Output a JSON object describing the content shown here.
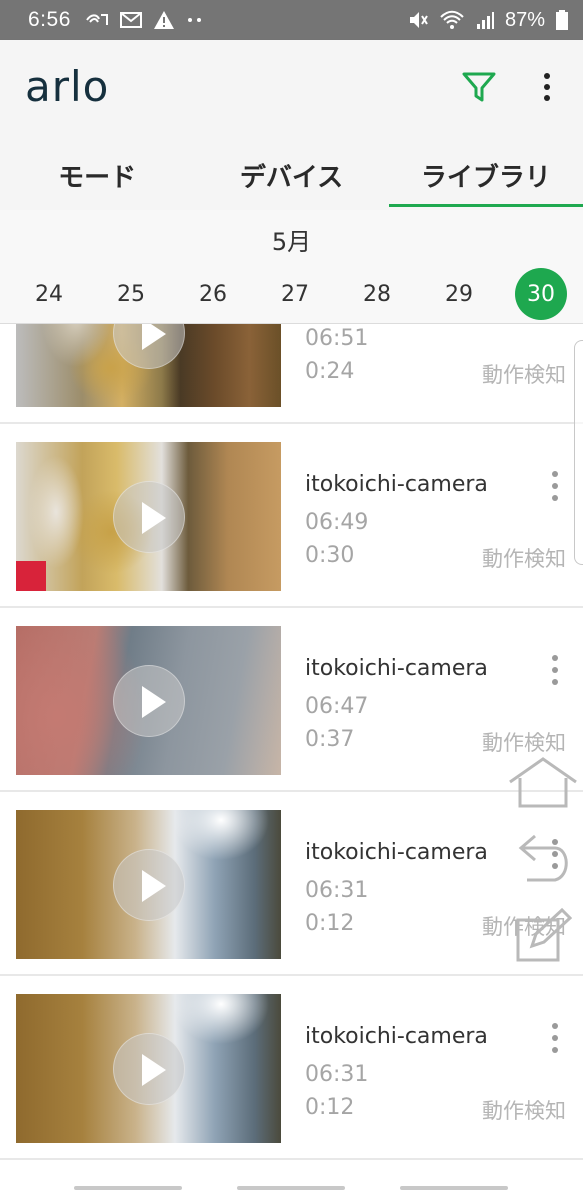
{
  "status_bar": {
    "time": "6:56",
    "battery": "87%",
    "left_icons": [
      "cast-icon",
      "mail-icon",
      "warning-icon",
      "more-dots-icon"
    ],
    "right_icons": [
      "mute-icon",
      "wifi-icon",
      "signal-icon",
      "battery-icon"
    ]
  },
  "header": {
    "logo": "arlo",
    "accent_color": "#1ea84f",
    "filter_icon": "filter-icon",
    "overflow_icon": "more-vert-icon"
  },
  "tabs": [
    {
      "label": "モード",
      "active": false
    },
    {
      "label": "デバイス",
      "active": false
    },
    {
      "label": "ライブラリ",
      "active": true
    }
  ],
  "date_strip": {
    "month": "5月",
    "days": [
      "24",
      "25",
      "26",
      "27",
      "28",
      "29",
      "30"
    ],
    "selected": "30"
  },
  "recordings": [
    {
      "camera": "",
      "time": "06:51",
      "duration": "0:24",
      "type": "動作検知"
    },
    {
      "camera": "itokoichi-camera",
      "time": "06:49",
      "duration": "0:30",
      "type": "動作検知"
    },
    {
      "camera": "itokoichi-camera",
      "time": "06:47",
      "duration": "0:37",
      "type": "動作検知"
    },
    {
      "camera": "itokoichi-camera",
      "time": "06:31",
      "duration": "0:12",
      "type": "動作検知"
    },
    {
      "camera": "itokoichi-camera",
      "time": "06:31",
      "duration": "0:12",
      "type": "動作検知"
    }
  ],
  "overlay_controls": [
    "home-icon",
    "back-icon",
    "edit-icon"
  ]
}
